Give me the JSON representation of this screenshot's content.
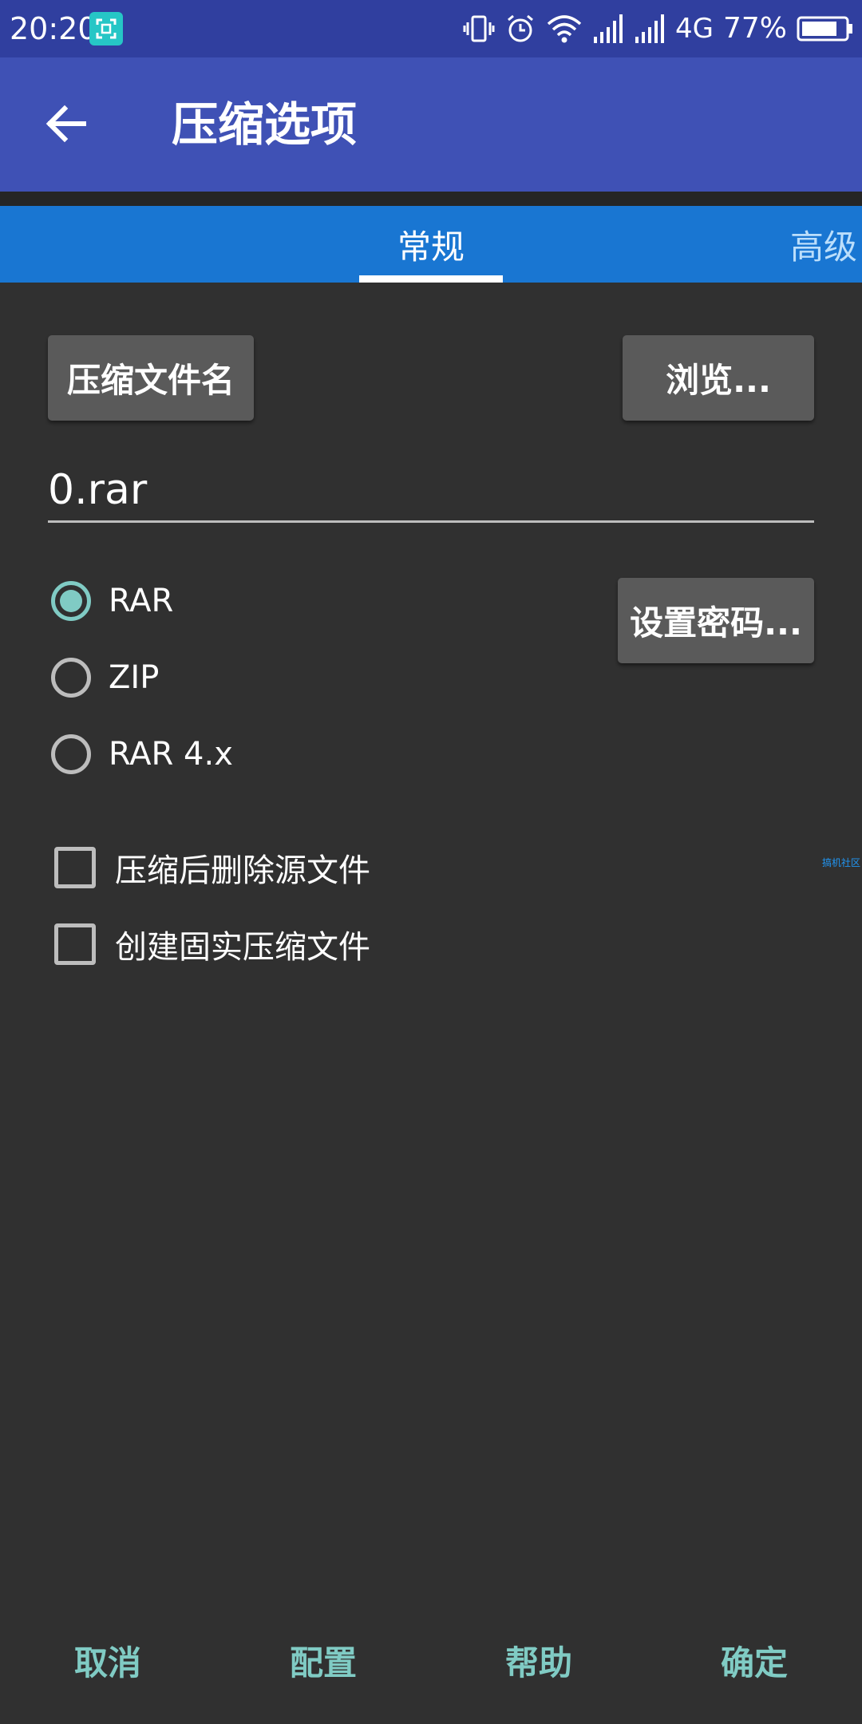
{
  "status_bar": {
    "time": "20:20",
    "network": "4G",
    "battery": "77%"
  },
  "toolbar": {
    "title": "压缩选项"
  },
  "tabs": [
    {
      "label": "常规",
      "selected": true
    },
    {
      "label": "高级",
      "selected": false
    }
  ],
  "general": {
    "archive_name_button": "压缩文件名",
    "browse_button": "浏览...",
    "filename_value": "0.rar",
    "set_password_button": "设置密码...",
    "formats": [
      {
        "label": "RAR",
        "checked": true
      },
      {
        "label": "ZIP",
        "checked": false
      },
      {
        "label": "RAR 4.x",
        "checked": false
      }
    ],
    "options": [
      {
        "label": "压缩后删除源文件",
        "checked": false
      },
      {
        "label": "创建固实压缩文件",
        "checked": false
      }
    ]
  },
  "watermark": "搞机社区",
  "actions": {
    "cancel": "取消",
    "config": "配置",
    "help": "帮助",
    "ok": "确定"
  },
  "colors": {
    "status_bar": "#303f9f",
    "toolbar": "#3f51b5",
    "tab_bar": "#1976d2",
    "background": "#303030",
    "accent": "#80cbc4"
  }
}
